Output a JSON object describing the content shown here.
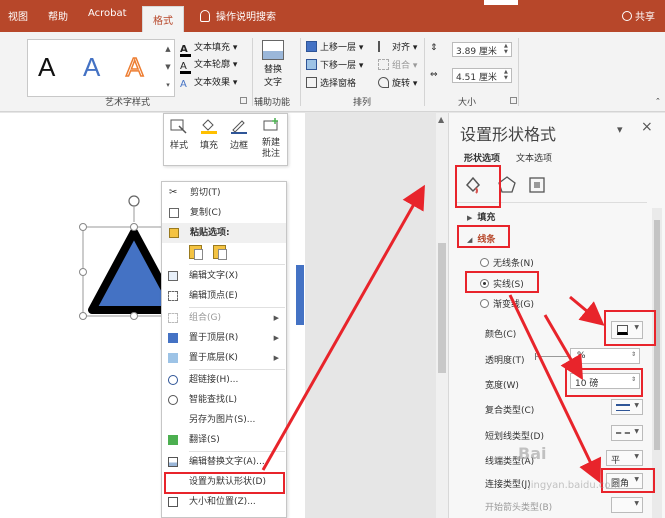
{
  "colors": {
    "accent": "#b7472a",
    "shape_fill": "#4472c4",
    "annotation": "#e8242b"
  },
  "tabs": [
    "视图",
    "帮助",
    "Acrobat",
    "格式"
  ],
  "tell_me": "操作说明搜索",
  "share": "共享",
  "ribbon": {
    "wordart_samples": [
      "A",
      "A",
      "A"
    ],
    "text_fill": "文本填充",
    "text_outline": "文本轮廓",
    "text_effects": "文本效果",
    "alt_text_line1": "替换",
    "alt_text_line2": "文字",
    "bring_forward": "上移一层",
    "send_backward": "下移一层",
    "selection_pane": "选择窗格",
    "align": "对齐",
    "group": "组合",
    "rotate": "旋转",
    "height": "3.89 厘米",
    "width": "4.51 厘米",
    "group_wordart": "艺术字样式",
    "group_accessibility": "辅助功能",
    "group_arrange": "排列",
    "group_size": "大小"
  },
  "mini_toolbar": [
    {
      "label": "样式",
      "icon": "shape-style-icon"
    },
    {
      "label": "填充",
      "icon": "fill-bucket-icon"
    },
    {
      "label": "边框",
      "icon": "outline-pen-icon"
    },
    {
      "label": "新建批注",
      "icon": "new-comment-icon"
    }
  ],
  "context_menu": {
    "cut": "剪切(T)",
    "copy": "复制(C)",
    "paste_options": "粘贴选项:",
    "edit_text": "编辑文字(X)",
    "edit_points": "编辑顶点(E)",
    "group": "组合(G)",
    "bring_to_front": "置于顶层(R)",
    "send_to_back": "置于底层(K)",
    "hyperlink": "超链接(H)...",
    "smart_lookup": "智能查找(L)",
    "save_as_picture": "另存为图片(S)...",
    "translate": "翻译(S)",
    "edit_alt_text": "编辑替换文字(A)...",
    "set_default_shape": "设置为默认形状(D)",
    "size_position": "大小和位置(Z)..."
  },
  "pane": {
    "title": "设置形状格式",
    "tab_shape": "形状选项",
    "tab_text": "文本选项",
    "fill": "填充",
    "line": "线条",
    "no_line": "无线条(N)",
    "solid_line": "实线(S)",
    "gradient_line": "渐变线(G)",
    "color": "颜色(C)",
    "transparency": "透明度(T)",
    "transparency_value": "%",
    "width": "宽度(W)",
    "width_value": "10 磅",
    "compound_type": "复合类型(C)",
    "dash_type": "短划线类型(D)",
    "cap_type": "线端类型(A)",
    "cap_value": "平",
    "join_type": "连接类型(J)",
    "join_value": "圆角",
    "begin_arrow": "开始箭头类型(B)"
  },
  "watermark": "Bai",
  "watermark_sub": "jingyan.baidu.com"
}
